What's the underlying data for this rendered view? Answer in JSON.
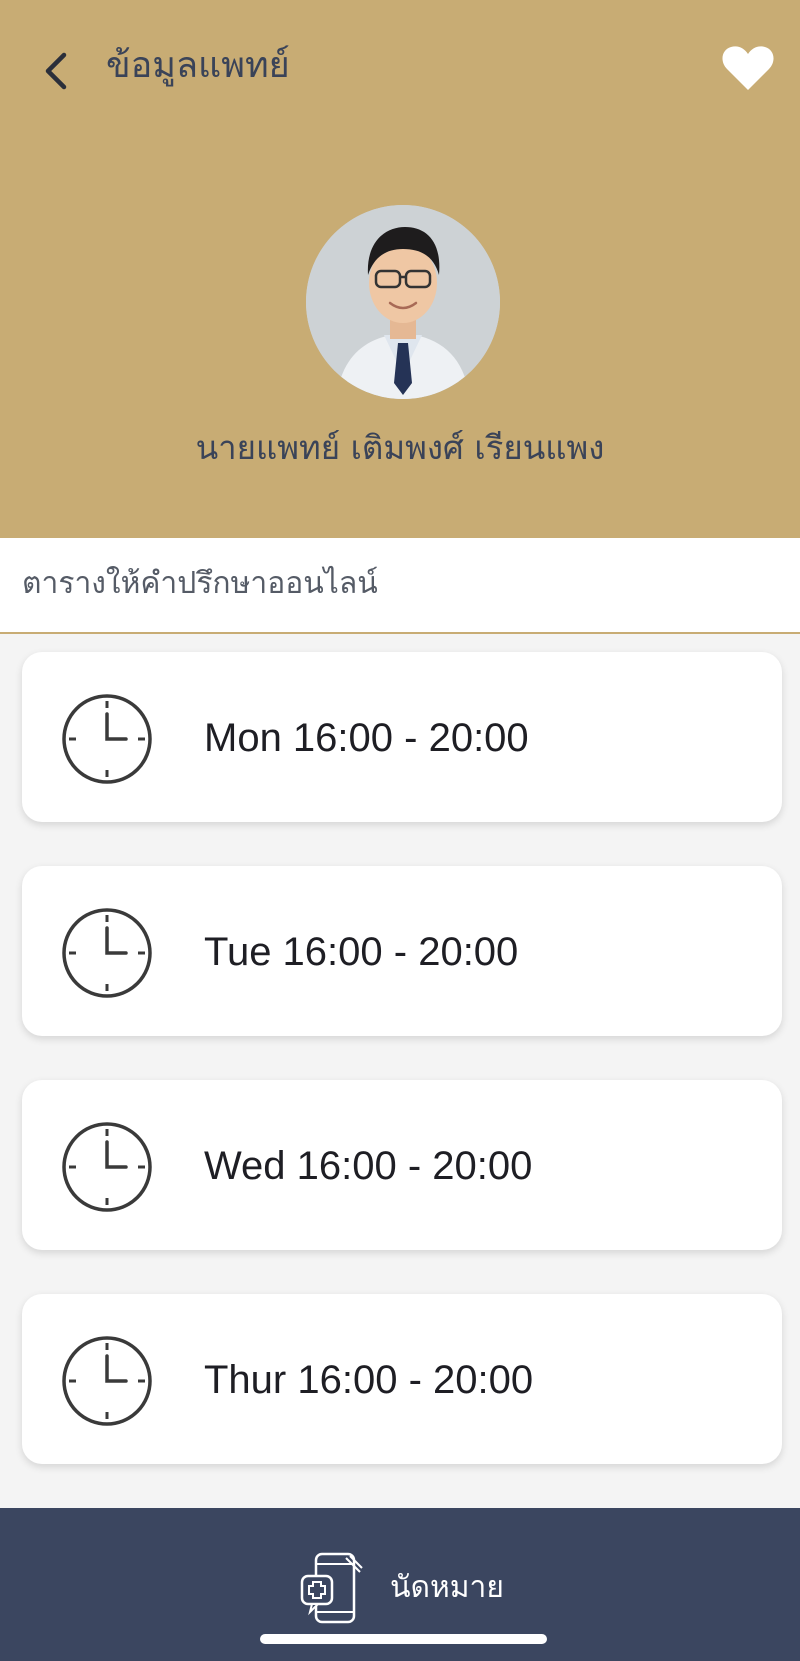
{
  "header": {
    "title": "ข้อมูลแพทย์",
    "back_icon": "chevron-left-icon",
    "favorite_icon": "heart-icon",
    "background_color": "#c8ac74"
  },
  "doctor": {
    "name": "นายแพทย์ เติมพงศ์ เรียนแพง",
    "avatar_icon": "doctor-photo"
  },
  "schedule": {
    "title": "ตารางให้คำปรึกษาออนไลน์",
    "items": [
      {
        "label": "Mon 16:00 - 20:00",
        "icon": "clock-icon"
      },
      {
        "label": "Tue 16:00 - 20:00",
        "icon": "clock-icon"
      },
      {
        "label": "Wed 16:00 - 20:00",
        "icon": "clock-icon"
      },
      {
        "label": "Thur 16:00 - 20:00",
        "icon": "clock-icon"
      }
    ]
  },
  "bottom_bar": {
    "appointment_label": "นัดหมาย",
    "appointment_icon": "phone-medical-icon",
    "background_color": "#3b4660"
  }
}
